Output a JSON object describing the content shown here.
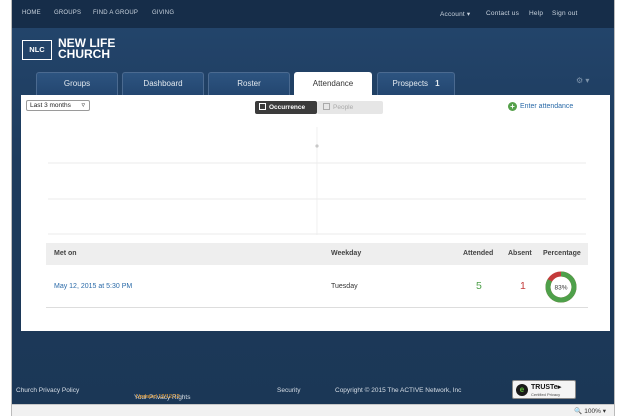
{
  "top_nav": {
    "left": [
      "HOME",
      "GROUPS",
      "FIND A GROUP",
      "GIVING"
    ],
    "account": "Account ▾",
    "contact": "Contact us",
    "help": "Help",
    "signout": "Sign out"
  },
  "logo": {
    "badge": "NLC",
    "line1": "NEW LIFE",
    "line2": "CHURCH"
  },
  "tabs": [
    {
      "label": "Groups"
    },
    {
      "label": "Dashboard"
    },
    {
      "label": "Roster"
    },
    {
      "label": "Attendance"
    },
    {
      "label": "Prospects",
      "badge": "1"
    }
  ],
  "settings_icon": "⚙ ▾",
  "filter": {
    "range": "Last 3 months",
    "chevron": "▿"
  },
  "view_toggle": {
    "active": "Occurrence",
    "inactive": "People"
  },
  "enter_attendance": {
    "icon": "+",
    "label": "Enter attendance"
  },
  "table": {
    "headers": [
      "Met on",
      "Weekday",
      "Attended",
      "Absent",
      "Percentage"
    ],
    "rows": [
      {
        "met_on": "May 12, 2015 at 5:30 PM",
        "weekday": "Tuesday",
        "attended": "5",
        "absent": "1",
        "percentage": "83%",
        "percentage_value": 0.83
      }
    ]
  },
  "colors": {
    "attended": "#4ea04a",
    "absent": "#c43b3b",
    "link": "#2a6aa8",
    "nav_bg": "#1d3b5d"
  },
  "footer": {
    "privacy": "Church Privacy Policy",
    "rights": "Your Privacy Rights",
    "rights_updated": "Updated 12/12/13",
    "security": "Security",
    "copyright": "Copyright © 2015 The ACTIVE Network, Inc",
    "truste": "TRUSTe▸",
    "truste_sub": "Certified Privacy"
  },
  "status_bar": {
    "zoom": "🔍 100%  ▾"
  }
}
